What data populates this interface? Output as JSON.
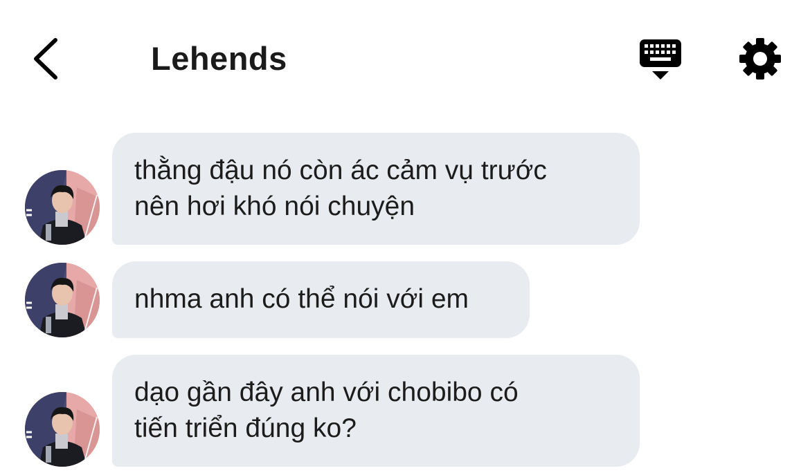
{
  "header": {
    "title": "Lehends",
    "back_icon": "chevron-left-icon",
    "keyboard_icon": "keyboard-icon",
    "settings_icon": "gear-icon"
  },
  "messages": [
    {
      "lines": [
        "thằng đậu nó còn ác cảm vụ trước",
        "nên hơi khó nói chuyện"
      ]
    },
    {
      "lines": [
        "nhma anh có thể nói với em"
      ]
    },
    {
      "lines": [
        "dạo gần đây anh với chobibo có",
        "tiến triển đúng ko?"
      ]
    }
  ],
  "colors": {
    "bubble": "#e8ebef",
    "text": "#1c1c1c",
    "icon": "#000000"
  }
}
